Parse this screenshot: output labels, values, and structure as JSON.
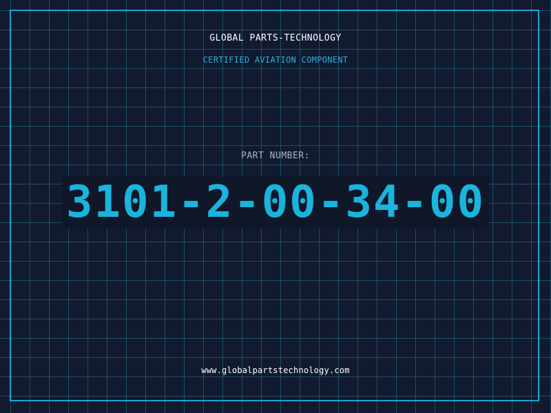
{
  "header": {
    "company": "GLOBAL PARTS-TECHNOLOGY",
    "tagline": "CERTIFIED AVIATION COMPONENT"
  },
  "part": {
    "label": "PART NUMBER:",
    "number": "3101-2-00-34-00"
  },
  "footer": {
    "website": "www.globalpartstechnology.com"
  },
  "colors": {
    "background": "#111a2f",
    "grid": "#28788f",
    "accent": "#1ab4dc",
    "text": "#ffffff",
    "label": "#a8b4c4"
  }
}
